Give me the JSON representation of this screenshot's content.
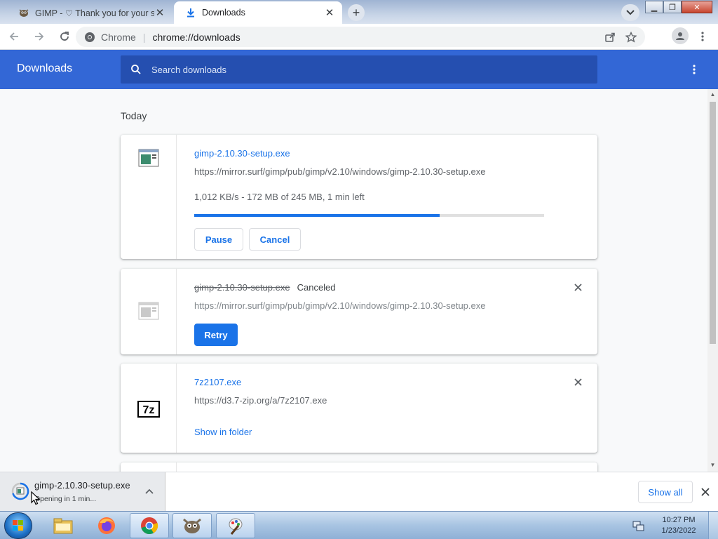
{
  "browser": {
    "tabs": [
      {
        "title": "GIMP - ♡ Thank you for your support!",
        "favicon": "gimp-icon",
        "active": false
      },
      {
        "title": "Downloads",
        "favicon": "download-icon",
        "active": true
      }
    ],
    "omnibox": {
      "site_label": "Chrome",
      "url": "chrome://downloads"
    }
  },
  "downloads_page": {
    "title": "Downloads",
    "search_placeholder": "Search downloads",
    "date_group": "Today",
    "items": [
      {
        "filename": "gimp-2.10.30-setup.exe",
        "url": "https://mirror.surf/gimp/pub/gimp/v2.10/windows/gimp-2.10.30-setup.exe",
        "status": "1,012 KB/s - 172 MB of 245 MB, 1 min left",
        "progress_fraction": 0.702,
        "actions": [
          "Pause",
          "Cancel"
        ]
      },
      {
        "filename": "gimp-2.10.30-setup.exe",
        "state": "Canceled",
        "url": "https://mirror.surf/gimp/pub/gimp/v2.10/windows/gimp-2.10.30-setup.exe",
        "actions": [
          "Retry"
        ]
      },
      {
        "filename": "7z2107.exe",
        "url": "https://d3.7-zip.org/a/7z2107.exe",
        "actions": [
          "Show in folder"
        ]
      }
    ]
  },
  "shelf": {
    "item_name": "gimp-2.10.30-setup.exe",
    "item_status": "Opening in 1 min...",
    "show_all": "Show all"
  },
  "taskbar": {
    "time": "10:27 PM",
    "date": "1/23/2022",
    "apps": [
      "file-explorer-icon",
      "firefox-icon",
      "chrome-icon",
      "gimp-icon",
      "paint-icon"
    ]
  },
  "colors": {
    "header_blue": "#3367d6",
    "link_blue": "#1a73e8"
  }
}
